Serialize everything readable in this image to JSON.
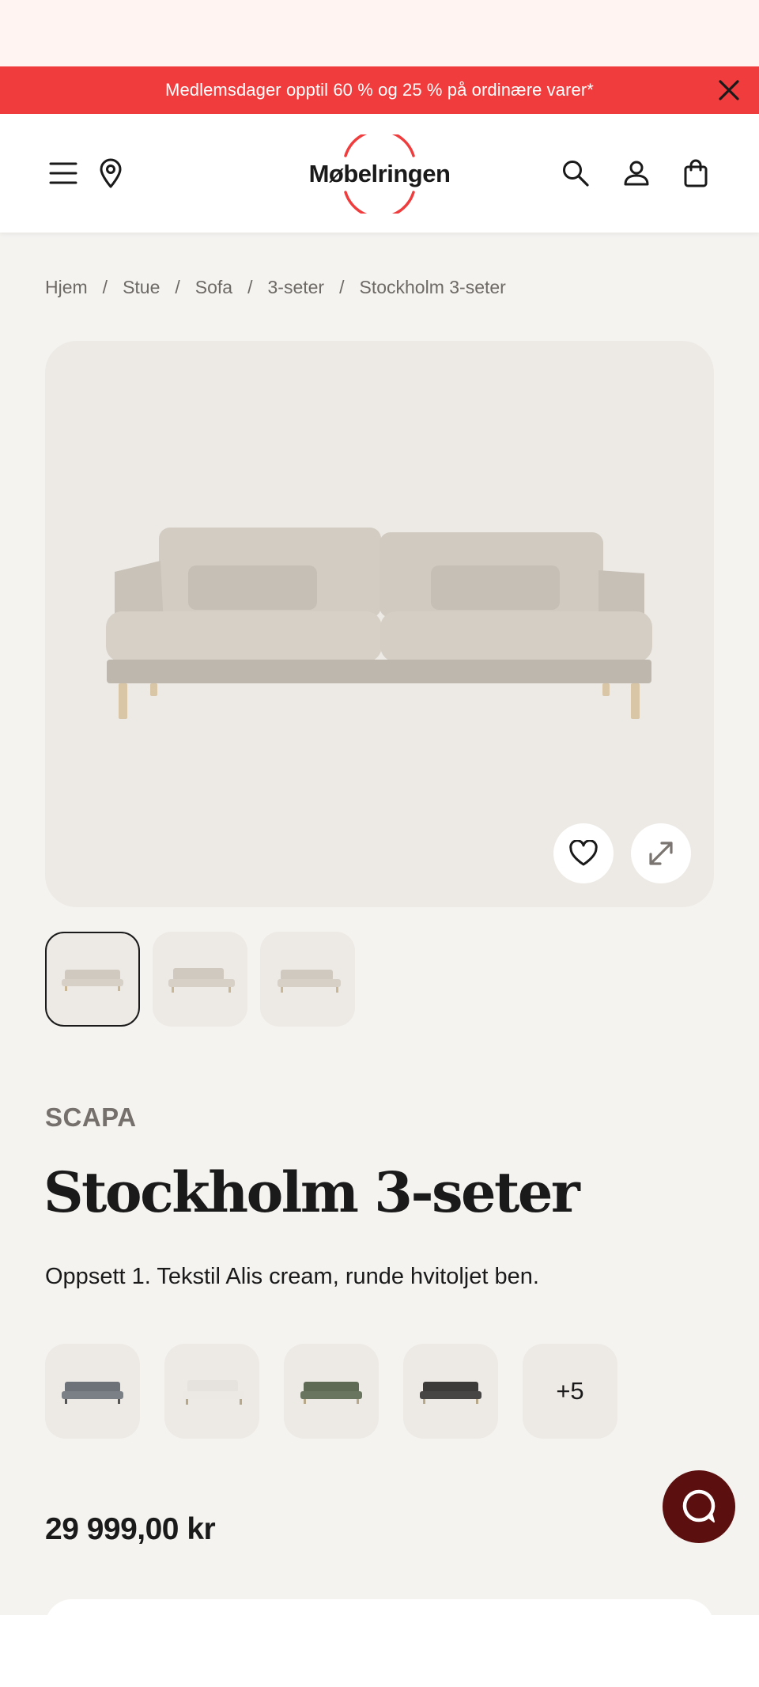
{
  "promo": {
    "text": "Medlemsdager opptil 60 % og 25 % på ordinære varer*",
    "color": "#f03c3c"
  },
  "header": {
    "logo_text": "Møbelringen",
    "icons": [
      "menu-icon",
      "location-pin-icon",
      "search-icon",
      "user-icon",
      "shopping-bag-icon"
    ]
  },
  "breadcrumb": {
    "items": [
      "Hjem",
      "Stue",
      "Sofa",
      "3-seter"
    ],
    "current": "Stockholm 3-seter",
    "separator": "/"
  },
  "product": {
    "brand": "SCAPA",
    "title": "Stockholm 3-seter",
    "description": "Oppsett 1. Tekstil Alis cream, runde hvitoljet ben.",
    "price": "29 999,00 kr",
    "more_variants": "+5"
  },
  "colors": {
    "accent": "#f03c3c",
    "chat": "#5c0f0f",
    "gallery_bg": "#edeae5",
    "page_bg": "#f5f3f0"
  },
  "variants": [
    {
      "name": "grey",
      "color": "#6d7278"
    },
    {
      "name": "white",
      "color": "#e6e3de"
    },
    {
      "name": "green",
      "color": "#5f6a55"
    },
    {
      "name": "dark",
      "color": "#3c3b39"
    }
  ]
}
